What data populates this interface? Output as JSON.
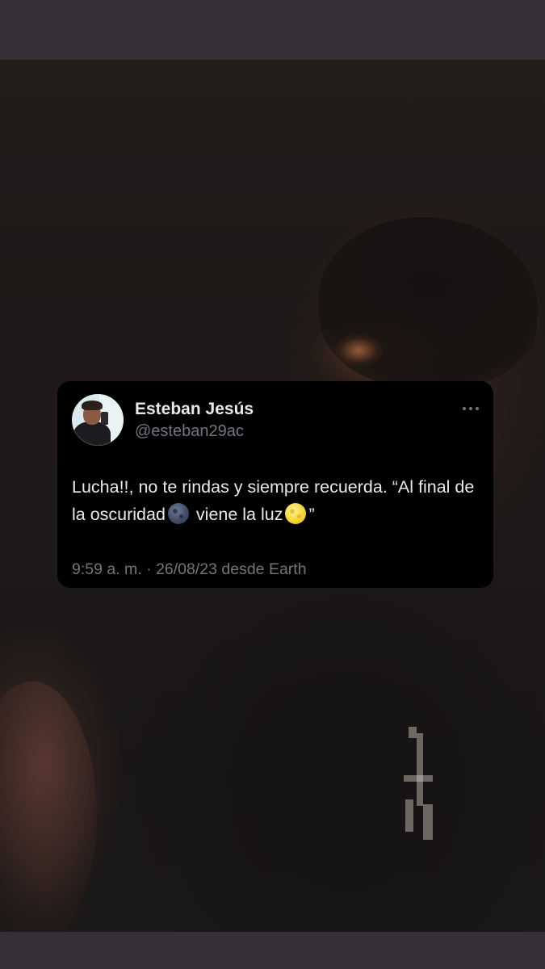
{
  "tweet": {
    "author_name": "Esteban Jesús",
    "author_handle": "@esteban29ac",
    "text_part1": "Lucha!!, no te rindas y siempre recuerda. “Al final de la oscuridad",
    "emoji1": "new-moon-emoji",
    "text_part2": " viene la luz",
    "emoji2": "full-moon-emoji",
    "text_part3": "”",
    "time": "9:59 a. m.",
    "separator": "·",
    "date": "26/08/23",
    "source": "desde Earth"
  },
  "colors": {
    "card_background": "#000000",
    "primary_text": "#e7e9ea",
    "secondary_text": "#71767b",
    "frame_background": "#322f34"
  },
  "icons": {
    "more": "more-options-icon",
    "avatar": "profile-photo"
  }
}
